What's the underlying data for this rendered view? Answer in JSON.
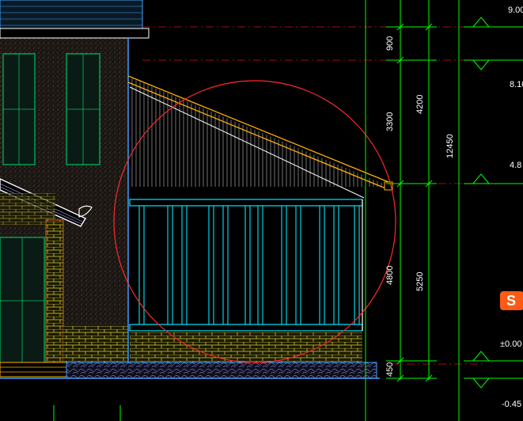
{
  "drawing": {
    "colors": {
      "background": "#000000",
      "dimension": "#00ff00",
      "wall_outline": "#3fa0ff",
      "railing": "#00e5ff",
      "roof": "#ffb000",
      "brick": "#f0e060",
      "highlight_circle": "#ff2a2a",
      "grid_dashed": "#d01010",
      "window_frame": "#00c060"
    },
    "dimensions": {
      "d900": "900",
      "d3300": "3300",
      "d4200": "4200",
      "d12450": "12450",
      "d4800": "4800",
      "d5250": "5250",
      "d450": "450"
    },
    "levels": {
      "l9": "9.00",
      "l8": "8.10",
      "l4": "4.8",
      "l0": "±0.00",
      "lneg": "-0.45"
    },
    "icons": {
      "watermark": "sogou-logo-icon"
    }
  }
}
